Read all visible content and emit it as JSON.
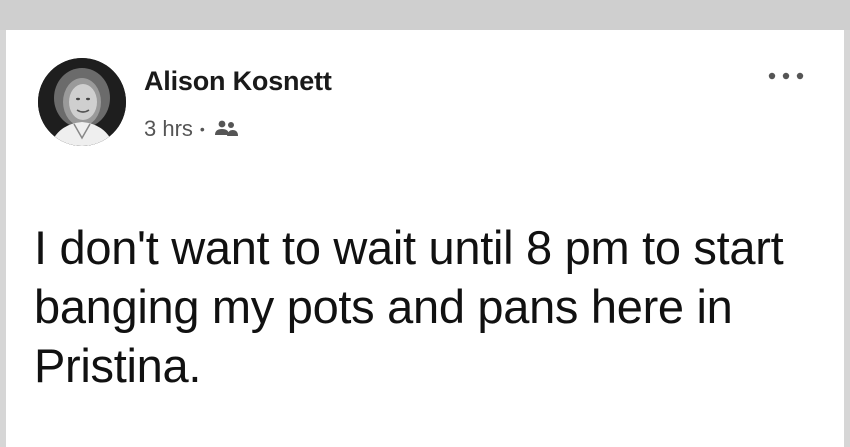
{
  "post": {
    "author_name": "Alison Kosnett",
    "timestamp": "3 hrs",
    "separator": "•",
    "audience_icon": "friends-icon",
    "more_icon": "more-options-icon",
    "body_text": "I don't want to wait until 8 pm to start banging my pots and pans here in Pristina."
  },
  "colors": {
    "top_bar": "#cfcfcf",
    "background": "#ffffff",
    "text": "#111111",
    "meta_text": "#555555"
  }
}
